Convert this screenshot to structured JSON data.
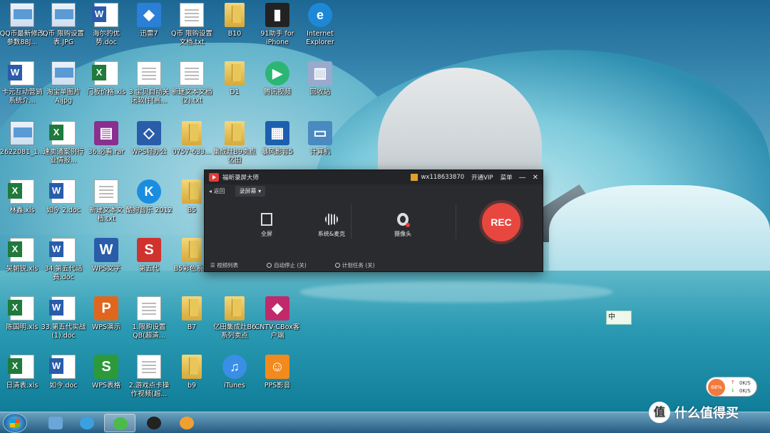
{
  "desktop": {
    "icons": [
      {
        "label": "QQ币最新修改参数88J...",
        "kind": "img"
      },
      {
        "label": "Q币 限购设置表.JPG",
        "kind": "img"
      },
      {
        "label": "海尔的优势.doc",
        "kind": "word"
      },
      {
        "label": "迅雷7",
        "kind": "app"
      },
      {
        "label": "Q币 限购设置文档.txt",
        "kind": "doc"
      },
      {
        "label": "B10",
        "kind": "folder"
      },
      {
        "label": "91助手 for iPhone",
        "kind": "app"
      },
      {
        "label": "Internet Explorer",
        "kind": "app"
      },
      {
        "label": "卡元互动营销系统介...",
        "kind": "word"
      },
      {
        "label": "淘宝单图片 A.jpg",
        "kind": "img"
      },
      {
        "label": "门板价格.xls",
        "kind": "xls"
      },
      {
        "label": "3.宝贝自动关闭软件(高...",
        "kind": "doc"
      },
      {
        "label": "新建文本文档 (2).txt",
        "kind": "doc"
      },
      {
        "label": "D1",
        "kind": "folder"
      },
      {
        "label": "腾讯视频",
        "kind": "app"
      },
      {
        "label": "回收站",
        "kind": "app"
      },
      {
        "label": "2622081_1...",
        "kind": "img"
      },
      {
        "label": "速卖通案例行业情报...",
        "kind": "xls"
      },
      {
        "label": "36.必看.rar",
        "kind": "app"
      },
      {
        "label": "WPS轻办公",
        "kind": "app"
      },
      {
        "label": "0757-633...",
        "kind": "folder"
      },
      {
        "label": "集成灶B9卖点亿田",
        "kind": "folder"
      },
      {
        "label": "暴风影音5",
        "kind": "app"
      },
      {
        "label": "计算机",
        "kind": "app"
      },
      {
        "label": "林鑫.xls",
        "kind": "xls"
      },
      {
        "label": "如今 2.doc",
        "kind": "word"
      },
      {
        "label": "新建文本文档.txt",
        "kind": "doc"
      },
      {
        "label": "酷狗音乐 2012",
        "kind": "app"
      },
      {
        "label": "B5",
        "kind": "folder"
      },
      {
        "label": "吴朝锐.xls",
        "kind": "xls"
      },
      {
        "label": "34.第五代话费.doc",
        "kind": "word"
      },
      {
        "label": "WPS文字",
        "kind": "app"
      },
      {
        "label": "第五代",
        "kind": "app"
      },
      {
        "label": "B5彩色系列",
        "kind": "folder"
      },
      {
        "label": "陈国明.xls",
        "kind": "xls"
      },
      {
        "label": "33.第五代实战 (1).doc",
        "kind": "word"
      },
      {
        "label": "WPS演示",
        "kind": "app"
      },
      {
        "label": "1.限购设置QB(超清...",
        "kind": "doc"
      },
      {
        "label": "B7",
        "kind": "folder"
      },
      {
        "label": "亿田集成灶B6系列卖点",
        "kind": "folder"
      },
      {
        "label": "CNTV-CBox客户端",
        "kind": "app"
      },
      {
        "label": "日清表.xls",
        "kind": "xls"
      },
      {
        "label": "如今.doc",
        "kind": "word"
      },
      {
        "label": "WPS表格",
        "kind": "app"
      },
      {
        "label": "2.游戏点卡操作视频(超...",
        "kind": "doc"
      },
      {
        "label": "b9",
        "kind": "folder"
      },
      {
        "label": "iTunes",
        "kind": "app"
      },
      {
        "label": "PPS影音",
        "kind": "app"
      }
    ]
  },
  "recorder": {
    "app_title": "福昕录屏大师",
    "user": "wx118633870",
    "vip": "开通VIP",
    "menu": "菜单",
    "min": "—",
    "close": "✕",
    "back": "返回",
    "mode": "录屏幕",
    "options": [
      {
        "label": "全屏",
        "icon": "screen-icon"
      },
      {
        "label": "系统&麦克",
        "icon": "audio-wave-icon"
      },
      {
        "label": "摄像头",
        "icon": "camera-icon"
      }
    ],
    "rec": "REC",
    "footer": {
      "list": "视频列表",
      "auto_stop": "自动停止 (关)",
      "schedule": "计划任务 (关)"
    },
    "accent": "#e8473f"
  },
  "widgets": {
    "ime": "中",
    "net_pct": "68%",
    "net_up": "0K/S",
    "net_down": "0K/S"
  },
  "watermark": {
    "badge": "值",
    "text": "什么值得买"
  }
}
